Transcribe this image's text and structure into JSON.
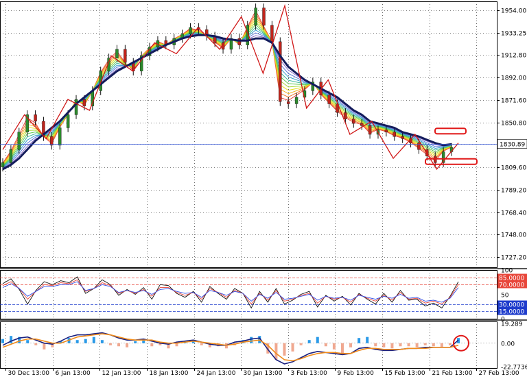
{
  "chart_data": [
    {
      "type": "line",
      "panel": "price",
      "y_ticks": [
        "1954.00",
        "1933.25",
        "1912.80",
        "1892.00",
        "1871.60",
        "1850.80",
        "1830.89",
        "1809.60",
        "1789.20",
        "1768.40",
        "1748.00",
        "1727.20"
      ],
      "y_tick_values": [
        1954.0,
        1933.25,
        1912.8,
        1892.0,
        1871.6,
        1850.8,
        1830.89,
        1809.6,
        1789.2,
        1768.4,
        1748.0,
        1727.2
      ],
      "ylim": [
        1718,
        1962
      ],
      "current_price": 1830.89,
      "current_price_label": "1830.89",
      "x_ticks": [
        "30 Dec 13:00",
        "6 Jan 13:00",
        "12 Jan 13:00",
        "18 Jan 13:00",
        "24 Jan 13:00",
        "30 Jan 13:00",
        "3 Feb 13:00",
        "9 Feb 13:00",
        "15 Feb 13:00",
        "21 Feb 13:00",
        "27 Feb 13:00"
      ],
      "grid": true,
      "close_series": [
        1814,
        1826,
        1842,
        1858,
        1852,
        1838,
        1830,
        1846,
        1858,
        1872,
        1866,
        1880,
        1898,
        1910,
        1918,
        1906,
        1898,
        1912,
        1920,
        1926,
        1922,
        1928,
        1932,
        1938,
        1936,
        1930,
        1924,
        1918,
        1928,
        1922,
        1940,
        1956,
        1940,
        1925,
        1870,
        1868,
        1874,
        1880,
        1888,
        1876,
        1868,
        1860,
        1854,
        1850,
        1848,
        1840,
        1844,
        1842,
        1838,
        1836,
        1832,
        1826,
        1820,
        1814,
        1824,
        1828
      ],
      "moving_average_series": [
        1808,
        1812,
        1818,
        1826,
        1834,
        1840,
        1846,
        1852,
        1860,
        1868,
        1874,
        1880,
        1886,
        1892,
        1898,
        1902,
        1906,
        1910,
        1914,
        1918,
        1922,
        1925,
        1928,
        1930,
        1931,
        1931,
        1930,
        1928,
        1927,
        1926,
        1926,
        1928,
        1928,
        1924,
        1912,
        1902,
        1896,
        1890,
        1886,
        1882,
        1878,
        1874,
        1868,
        1862,
        1858,
        1852,
        1850,
        1848,
        1846,
        1842,
        1840,
        1838,
        1835,
        1832,
        1830,
        1831
      ],
      "zigzag_points": [
        1826,
        1858,
        1836,
        1872,
        1862,
        1912,
        1898,
        1924,
        1914,
        1938,
        1918,
        1948,
        1896,
        1958,
        1864,
        1890,
        1840,
        1852,
        1818,
        1840,
        1808,
        1832
      ]
    },
    {
      "type": "line",
      "panel": "oscillator",
      "ylim": [
        0,
        100
      ],
      "y_ticks": [
        "100",
        "50",
        "0"
      ],
      "y_tick_values": [
        100,
        50,
        0
      ],
      "levels": [
        {
          "label": "85.0000",
          "value": 85,
          "color": "#e8463a"
        },
        {
          "label": "70.0000",
          "value": 70,
          "color": "#e8463a"
        },
        {
          "label": "30.0000",
          "value": 30,
          "color": "#1e3ccc"
        },
        {
          "label": "15.0000",
          "value": 15,
          "color": "#1e3ccc"
        }
      ],
      "series": [
        {
          "color": "#111111",
          "values": [
            72,
            82,
            60,
            30,
            58,
            76,
            70,
            78,
            74,
            86,
            52,
            62,
            80,
            70,
            48,
            60,
            50,
            64,
            40,
            70,
            68,
            52,
            44,
            56,
            34,
            66,
            52,
            40,
            62,
            52,
            22,
            56,
            34,
            62,
            30,
            38,
            50,
            56,
            24,
            48,
            36,
            46,
            28,
            52,
            40,
            30,
            52,
            34,
            58,
            38,
            40,
            26,
            32,
            22,
            46,
            76
          ]
        },
        {
          "color": "#e8463a",
          "values": [
            68,
            76,
            62,
            40,
            56,
            70,
            68,
            74,
            72,
            80,
            56,
            62,
            74,
            68,
            52,
            58,
            52,
            60,
            46,
            64,
            64,
            54,
            48,
            54,
            40,
            62,
            54,
            44,
            58,
            52,
            30,
            52,
            38,
            58,
            36,
            40,
            48,
            52,
            32,
            46,
            40,
            44,
            34,
            50,
            42,
            36,
            48,
            38,
            54,
            40,
            42,
            32,
            36,
            30,
            44,
            70
          ]
        },
        {
          "color": "#3050e8",
          "values": [
            64,
            72,
            62,
            46,
            56,
            66,
            66,
            70,
            70,
            76,
            58,
            62,
            70,
            66,
            54,
            58,
            54,
            58,
            50,
            60,
            62,
            56,
            52,
            54,
            44,
            58,
            54,
            48,
            56,
            52,
            36,
            50,
            42,
            54,
            40,
            42,
            46,
            50,
            38,
            46,
            42,
            44,
            38,
            48,
            44,
            40,
            46,
            42,
            50,
            42,
            44,
            36,
            38,
            34,
            42,
            64
          ]
        }
      ]
    },
    {
      "type": "bar",
      "panel": "histogram",
      "ylim": [
        -24,
        21
      ],
      "y_ticks": [
        "19.289",
        "0.00",
        "-22.7736"
      ],
      "y_tick_values": [
        19.289,
        0,
        -22.7736
      ],
      "histogram": [
        4,
        7,
        6,
        3,
        -2,
        -6,
        -4,
        2,
        5,
        3,
        4,
        6,
        3,
        -2,
        -3,
        -4,
        2,
        4,
        -3,
        -2,
        -5,
        -3,
        2,
        3,
        -2,
        -4,
        -3,
        -5,
        -2,
        3,
        6,
        7,
        -10,
        -16,
        -12,
        -8,
        -2,
        3,
        6,
        -3,
        -6,
        -10,
        -4,
        5,
        6,
        -3,
        -4,
        -5,
        -3,
        -3,
        -4,
        -2,
        -3,
        -4,
        -2,
        5
      ],
      "line_fast": [
        -2,
        2,
        5,
        6,
        3,
        0,
        -1,
        2,
        6,
        8,
        8,
        9,
        10,
        8,
        5,
        3,
        3,
        4,
        2,
        0,
        -1,
        1,
        2,
        3,
        1,
        -1,
        -2,
        -2,
        1,
        2,
        4,
        5,
        -6,
        -16,
        -20,
        -18,
        -14,
        -10,
        -8,
        -9,
        -10,
        -11,
        -10,
        -5,
        -4,
        -6,
        -7,
        -7,
        -6,
        -5,
        -5,
        -4,
        -4,
        -4,
        -4,
        3
      ],
      "line_slow": [
        -4,
        -1,
        2,
        4,
        4,
        2,
        0,
        0,
        3,
        6,
        7,
        8,
        9,
        8,
        6,
        4,
        3,
        3,
        3,
        1,
        0,
        0,
        1,
        2,
        1,
        0,
        -1,
        -2,
        -1,
        1,
        2,
        3,
        -2,
        -10,
        -16,
        -17,
        -15,
        -12,
        -10,
        -9,
        -9,
        -10,
        -10,
        -7,
        -5,
        -5,
        -6,
        -6,
        -6,
        -5,
        -5,
        -5,
        -4,
        -4,
        -4,
        -2
      ]
    }
  ]
}
